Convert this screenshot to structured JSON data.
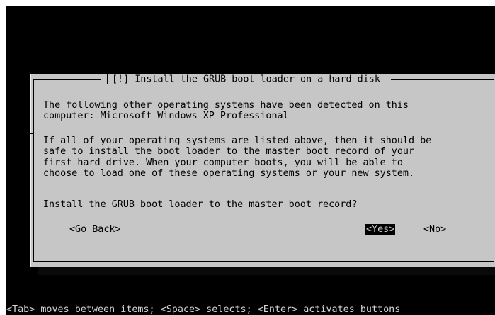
{
  "dialog": {
    "title": "[!] Install the GRUB boot loader on a hard disk",
    "paragraph1": "The following other operating systems have been detected on this\ncomputer: Microsoft Windows XP Professional",
    "paragraph2": "If all of your operating systems are listed above, then it should be\nsafe to install the boot loader to the master boot record of your\nfirst hard drive. When your computer boots, you will be able to\nchoose to load one of these operating systems or your new system.",
    "question": "Install the GRUB boot loader to the master boot record?",
    "buttons": {
      "back": "<Go Back>",
      "yes": "<Yes>",
      "no": "<No>"
    }
  },
  "status_line": "<Tab> moves between items; <Space> selects; <Enter> activates buttons",
  "colors": {
    "background": "#000000",
    "dialog": "#c6c6c6",
    "selected_button_bg": "#000000",
    "selected_button_fg": "#c6c6c6"
  }
}
